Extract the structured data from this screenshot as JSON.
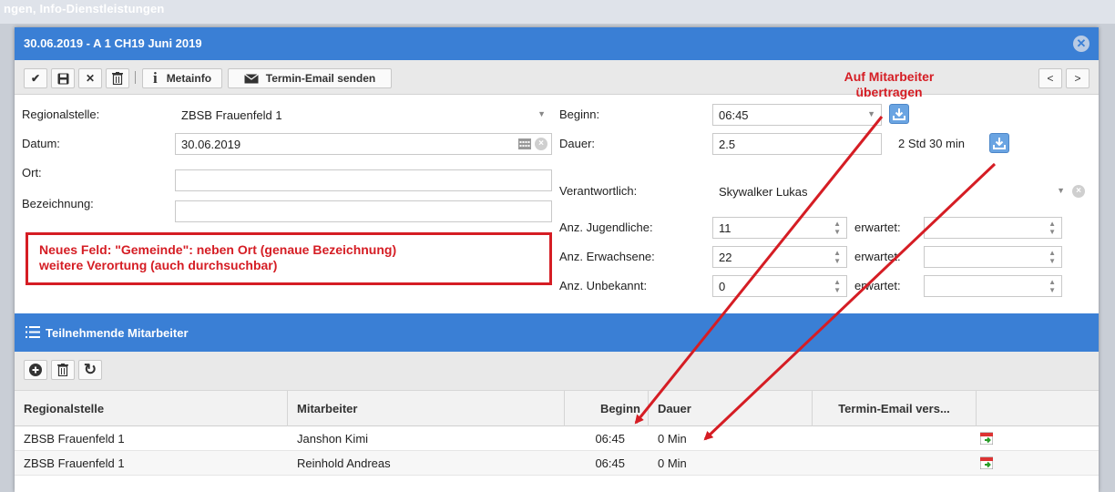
{
  "background": {
    "title": "ngen, Info-Dienstleistungen"
  },
  "window": {
    "title": "30.06.2019 - A 1 CH19 Juni 2019"
  },
  "toolbar": {
    "metainfo_label": "Metainfo",
    "email_label": "Termin-Email senden",
    "prev_label": "<",
    "next_label": ">"
  },
  "form": {
    "regionalstelle": {
      "label": "Regionalstelle:",
      "value": "ZBSB Frauenfeld 1"
    },
    "datum": {
      "label": "Datum:",
      "value": "30.06.2019"
    },
    "ort": {
      "label": "Ort:",
      "value": ""
    },
    "bezeichnung": {
      "label": "Bezeichnung:",
      "value": ""
    },
    "beginn": {
      "label": "Beginn:",
      "value": "06:45"
    },
    "dauer": {
      "label": "Dauer:",
      "value": "2.5",
      "text": "2 Std 30 min"
    },
    "verantwortlich": {
      "label": "Verantwortlich:",
      "value": "Skywalker Lukas"
    },
    "jugendliche": {
      "label": "Anz. Jugendliche:",
      "value": "11"
    },
    "erwachsene": {
      "label": "Anz. Erwachsene:",
      "value": "22"
    },
    "unbekannt": {
      "label": "Anz. Unbekannt:",
      "value": "0"
    },
    "erwartet_label": "erwartet:"
  },
  "annotations": {
    "callout_line1": "Neues Feld: \"Gemeinde\": neben Ort (genaue Bezeichnung)",
    "callout_line2": "weitere Verortung (auch durchsuchbar)",
    "arrow_line1": "Auf Mitarbeiter",
    "arrow_line2": "übertragen",
    "color": "#d51d24"
  },
  "section": {
    "title": "Teilnehmende Mitarbeiter"
  },
  "grid": {
    "columns": [
      "Regionalstelle",
      "Mitarbeiter",
      "Beginn",
      "Dauer",
      "Termin-Email vers..."
    ],
    "rows": [
      {
        "regionalstelle": "ZBSB Frauenfeld 1",
        "mitarbeiter": "Janshon Kimi",
        "beginn": "06:45",
        "dauer": "0 Min"
      },
      {
        "regionalstelle": "ZBSB Frauenfeld 1",
        "mitarbeiter": "Reinhold Andreas",
        "beginn": "06:45",
        "dauer": "0 Min"
      }
    ]
  },
  "colors": {
    "header_blue": "#3a7fd5",
    "toolbar_gray": "#e9e9e9",
    "accent_red": "#d51d24"
  }
}
